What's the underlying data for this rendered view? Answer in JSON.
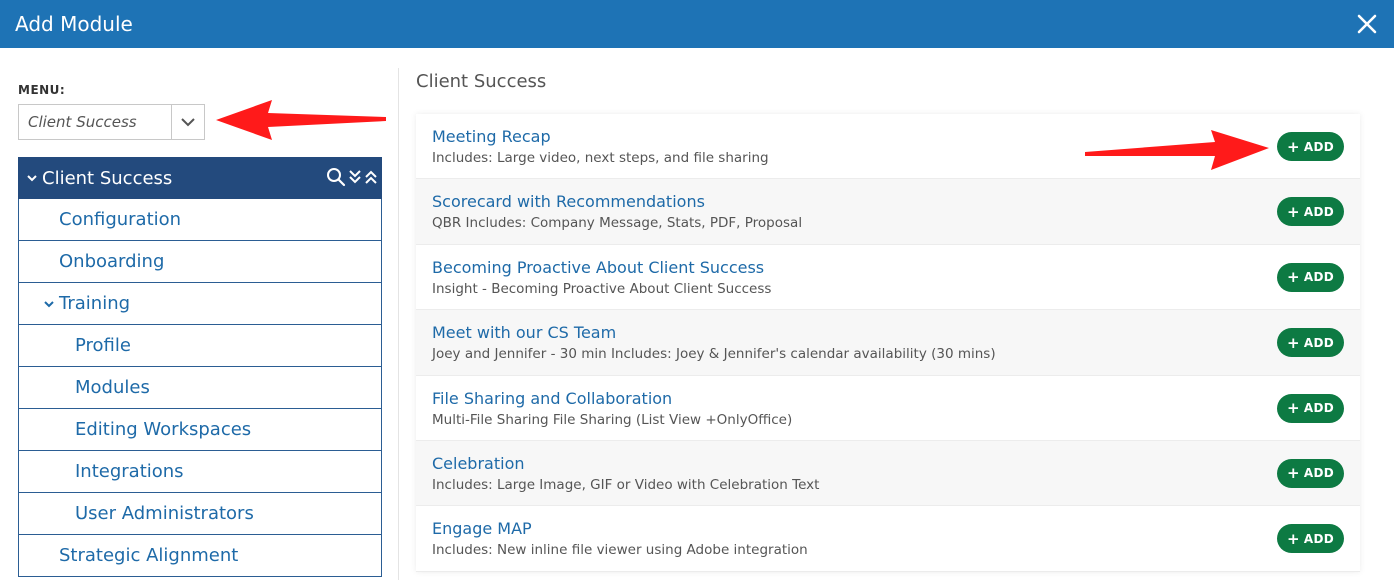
{
  "header": {
    "title": "Add Module"
  },
  "menu": {
    "label": "MENU:",
    "selected": "Client Success"
  },
  "tree": {
    "head": "Client Success",
    "items": [
      {
        "label": "Configuration",
        "level": 1
      },
      {
        "label": "Onboarding",
        "level": 1
      },
      {
        "label": "Training",
        "level": 1,
        "expanded": true
      },
      {
        "label": "Profile",
        "level": 2
      },
      {
        "label": "Modules",
        "level": 2
      },
      {
        "label": "Editing Workspaces",
        "level": 2
      },
      {
        "label": "Integrations",
        "level": 2
      },
      {
        "label": "User Administrators",
        "level": 2
      },
      {
        "label": "Strategic Alignment",
        "level": 1
      }
    ]
  },
  "main": {
    "section_title": "Client Success",
    "add_label": "ADD",
    "modules": [
      {
        "title": "Meeting Recap",
        "desc": "Includes: Large video, next steps, and file sharing"
      },
      {
        "title": "Scorecard with Recommendations",
        "desc": "QBR Includes: Company Message, Stats, PDF, Proposal"
      },
      {
        "title": "Becoming Proactive About Client Success",
        "desc": "Insight - Becoming Proactive About Client Success"
      },
      {
        "title": "Meet with our CS Team",
        "desc": "Joey and Jennifer - 30 min Includes: Joey & Jennifer's calendar availability (30 mins)"
      },
      {
        "title": "File Sharing and Collaboration",
        "desc": "Multi-File Sharing File Sharing (List View +OnlyOffice)"
      },
      {
        "title": "Celebration",
        "desc": "Includes: Large Image, GIF or Video with Celebration Text"
      },
      {
        "title": "Engage MAP",
        "desc": "Includes: New inline file viewer using Adobe integration"
      }
    ]
  },
  "colors": {
    "header": "#1e73b5",
    "tree_head": "#234a7d",
    "add_button": "#0d7a43",
    "link": "#1e6aa8",
    "annotation_arrow": "#ff1a1a"
  }
}
